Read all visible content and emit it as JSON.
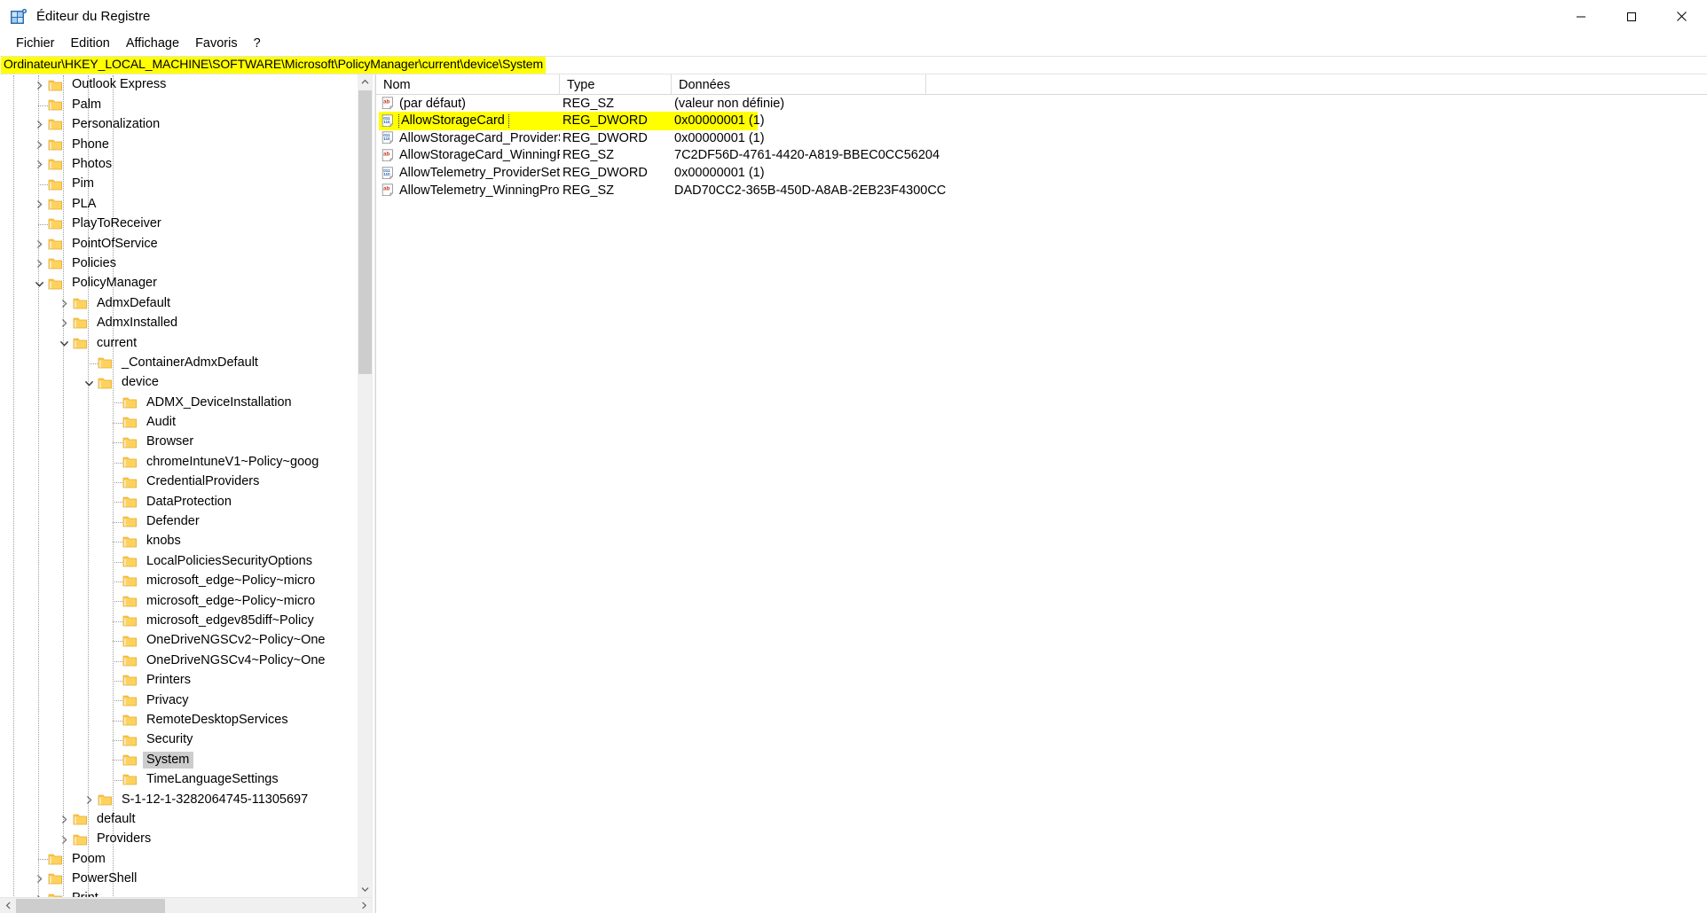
{
  "window": {
    "title": "Éditeur du Registre",
    "icon": "registry-editor-icon",
    "controls": {
      "minimize": "minimize-icon",
      "maximize": "maximize-icon",
      "close": "close-icon"
    }
  },
  "menu": {
    "items": [
      {
        "label": "Fichier",
        "name": "menu-fichier"
      },
      {
        "label": "Edition",
        "name": "menu-edition"
      },
      {
        "label": "Affichage",
        "name": "menu-affichage"
      },
      {
        "label": "Favoris",
        "name": "menu-favoris"
      },
      {
        "label": "?",
        "name": "menu-aide"
      }
    ]
  },
  "address": {
    "path": "Ordinateur\\HKEY_LOCAL_MACHINE\\SOFTWARE\\Microsoft\\PolicyManager\\current\\device\\System",
    "highlight_color": "#ffff00"
  },
  "tree": {
    "items": [
      {
        "label": "Outlook Express",
        "depth": 2,
        "state": "collapsed",
        "selected": false
      },
      {
        "label": "Palm",
        "depth": 2,
        "state": "leaf",
        "selected": false
      },
      {
        "label": "Personalization",
        "depth": 2,
        "state": "collapsed",
        "selected": false
      },
      {
        "label": "Phone",
        "depth": 2,
        "state": "collapsed",
        "selected": false
      },
      {
        "label": "Photos",
        "depth": 2,
        "state": "collapsed",
        "selected": false
      },
      {
        "label": "Pim",
        "depth": 2,
        "state": "leaf",
        "selected": false
      },
      {
        "label": "PLA",
        "depth": 2,
        "state": "collapsed",
        "selected": false
      },
      {
        "label": "PlayToReceiver",
        "depth": 2,
        "state": "leaf",
        "selected": false
      },
      {
        "label": "PointOfService",
        "depth": 2,
        "state": "collapsed",
        "selected": false
      },
      {
        "label": "Policies",
        "depth": 2,
        "state": "collapsed",
        "selected": false
      },
      {
        "label": "PolicyManager",
        "depth": 2,
        "state": "expanded",
        "selected": false
      },
      {
        "label": "AdmxDefault",
        "depth": 3,
        "state": "collapsed",
        "selected": false
      },
      {
        "label": "AdmxInstalled",
        "depth": 3,
        "state": "collapsed",
        "selected": false
      },
      {
        "label": "current",
        "depth": 3,
        "state": "expanded",
        "selected": false
      },
      {
        "label": "_ContainerAdmxDefault",
        "depth": 4,
        "state": "leaf",
        "selected": false
      },
      {
        "label": "device",
        "depth": 4,
        "state": "expanded",
        "selected": false
      },
      {
        "label": "ADMX_DeviceInstallation",
        "depth": 5,
        "state": "leaf",
        "selected": false
      },
      {
        "label": "Audit",
        "depth": 5,
        "state": "leaf",
        "selected": false
      },
      {
        "label": "Browser",
        "depth": 5,
        "state": "leaf",
        "selected": false
      },
      {
        "label": "chromeIntuneV1~Policy~goog",
        "depth": 5,
        "state": "leaf",
        "selected": false
      },
      {
        "label": "CredentialProviders",
        "depth": 5,
        "state": "leaf",
        "selected": false
      },
      {
        "label": "DataProtection",
        "depth": 5,
        "state": "leaf",
        "selected": false
      },
      {
        "label": "Defender",
        "depth": 5,
        "state": "leaf",
        "selected": false
      },
      {
        "label": "knobs",
        "depth": 5,
        "state": "leaf",
        "selected": false
      },
      {
        "label": "LocalPoliciesSecurityOptions",
        "depth": 5,
        "state": "leaf",
        "selected": false
      },
      {
        "label": "microsoft_edge~Policy~micro",
        "depth": 5,
        "state": "leaf",
        "selected": false
      },
      {
        "label": "microsoft_edge~Policy~micro",
        "depth": 5,
        "state": "leaf",
        "selected": false
      },
      {
        "label": "microsoft_edgev85diff~Policy",
        "depth": 5,
        "state": "leaf",
        "selected": false
      },
      {
        "label": "OneDriveNGSCv2~Policy~One",
        "depth": 5,
        "state": "leaf",
        "selected": false
      },
      {
        "label": "OneDriveNGSCv4~Policy~One",
        "depth": 5,
        "state": "leaf",
        "selected": false
      },
      {
        "label": "Printers",
        "depth": 5,
        "state": "leaf",
        "selected": false
      },
      {
        "label": "Privacy",
        "depth": 5,
        "state": "leaf",
        "selected": false
      },
      {
        "label": "RemoteDesktopServices",
        "depth": 5,
        "state": "leaf",
        "selected": false
      },
      {
        "label": "Security",
        "depth": 5,
        "state": "leaf",
        "selected": false
      },
      {
        "label": "System",
        "depth": 5,
        "state": "leaf",
        "selected": true
      },
      {
        "label": "TimeLanguageSettings",
        "depth": 5,
        "state": "leaf",
        "selected": false
      },
      {
        "label": "S-1-12-1-3282064745-11305697",
        "depth": 4,
        "state": "collapsed",
        "selected": false
      },
      {
        "label": "default",
        "depth": 3,
        "state": "collapsed",
        "selected": false
      },
      {
        "label": "Providers",
        "depth": 3,
        "state": "collapsed",
        "selected": false
      },
      {
        "label": "Poom",
        "depth": 2,
        "state": "leaf",
        "selected": false
      },
      {
        "label": "PowerShell",
        "depth": 2,
        "state": "collapsed",
        "selected": false
      },
      {
        "label": "Print",
        "depth": 2,
        "state": "collapsed",
        "selected": false
      }
    ]
  },
  "list": {
    "columns": [
      {
        "label": "Nom",
        "name": "column-header-name"
      },
      {
        "label": "Type",
        "name": "column-header-type"
      },
      {
        "label": "Données",
        "name": "column-header-data"
      }
    ],
    "rows": [
      {
        "name": "(par défaut)",
        "type": "REG_SZ",
        "data": "(valeur non définie)",
        "icon": "string-value-icon",
        "highlighted": false,
        "focused": false
      },
      {
        "name": "AllowStorageCard",
        "type": "REG_DWORD",
        "data": "0x00000001 (1)",
        "icon": "dword-value-icon",
        "highlighted": true,
        "focused": true
      },
      {
        "name": "AllowStorageCard_ProviderSet",
        "type": "REG_DWORD",
        "data": "0x00000001 (1)",
        "icon": "dword-value-icon",
        "highlighted": false,
        "focused": false
      },
      {
        "name": "AllowStorageCard_WinningProv…",
        "type": "REG_SZ",
        "data": "7C2DF56D-4761-4420-A819-BBEC0CC56204",
        "icon": "string-value-icon",
        "highlighted": false,
        "focused": false
      },
      {
        "name": "AllowTelemetry_ProviderSet",
        "type": "REG_DWORD",
        "data": "0x00000001 (1)",
        "icon": "dword-value-icon",
        "highlighted": false,
        "focused": false
      },
      {
        "name": "AllowTelemetry_WinningProvider",
        "type": "REG_SZ",
        "data": "DAD70CC2-365B-450D-A8AB-2EB23F4300CC",
        "icon": "string-value-icon",
        "highlighted": false,
        "focused": false
      }
    ]
  },
  "scrollbars": {
    "tree_vertical": {
      "up": "scroll-up-arrow",
      "down": "scroll-down-arrow"
    },
    "tree_horizontal": {
      "left": "scroll-left-arrow",
      "right": "scroll-right-arrow"
    }
  },
  "colors": {
    "highlight": "#ffff00",
    "selection": "#cdcdcd",
    "folder": "#ffd04d",
    "scrollbar_thumb": "#cdcdcd",
    "scrollbar_track": "#f0f0f0"
  }
}
